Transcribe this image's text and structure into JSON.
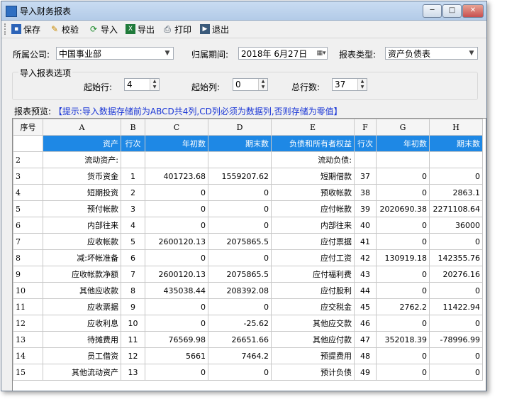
{
  "window": {
    "title": "导入财务报表",
    "min": "─",
    "max": "□",
    "close": "✕"
  },
  "toolbar": [
    {
      "label": "保存",
      "icon": "save-icon"
    },
    {
      "label": "校验",
      "icon": "check-icon"
    },
    {
      "label": "导入",
      "icon": "import-icon"
    },
    {
      "label": "导出",
      "icon": "export-icon"
    },
    {
      "label": "打印",
      "icon": "print-icon"
    },
    {
      "label": "退出",
      "icon": "exit-icon"
    }
  ],
  "form": {
    "company_label": "所属公司:",
    "company_value": "中国事业部",
    "period_label": "归属期间:",
    "period_value": "2018年  6月27日",
    "report_type_label": "报表类型:",
    "report_type_value": "资产负债表",
    "group_title": "导入报表选项",
    "start_row_label": "起始行:",
    "start_row_value": "4",
    "start_col_label": "起始列:",
    "start_col_value": "0",
    "total_rows_label": "总行数:",
    "total_rows_value": "37"
  },
  "preview": {
    "label": "报表预览:",
    "hint": "【提示:导入数据存储前为ABCD共4列,CD列必须为数据列,否则存储为零值】"
  },
  "grid": {
    "columns": [
      "序号",
      "A",
      "B",
      "C",
      "D",
      "E",
      "F",
      "G",
      "H"
    ],
    "header_row": [
      "",
      "资产",
      "行次",
      "年初数",
      "期末数",
      "负债和所有者权益",
      "行次",
      "年初数",
      "期末数"
    ],
    "rows": [
      [
        "2",
        "流动资产:",
        "",
        "",
        "",
        "流动负债:",
        "",
        "",
        ""
      ],
      [
        "3",
        "货币资金",
        "1",
        "401723.68",
        "1559207.62",
        "短期借款",
        "37",
        "0",
        "0"
      ],
      [
        "4",
        "短期投资",
        "2",
        "0",
        "0",
        "预收帐款",
        "38",
        "0",
        "2863.1"
      ],
      [
        "5",
        "预付帐款",
        "3",
        "0",
        "0",
        "应付帐款",
        "39",
        "2020690.38",
        "2271108.64"
      ],
      [
        "6",
        "内部往来",
        "4",
        "0",
        "0",
        "内部往来",
        "40",
        "0",
        "36000"
      ],
      [
        "7",
        "应收帐款",
        "5",
        "2600120.13",
        "2075865.5",
        "应付票据",
        "41",
        "0",
        "0"
      ],
      [
        "8",
        "减:坏帐准备",
        "6",
        "0",
        "0",
        "应付工资",
        "42",
        "130919.18",
        "142355.76"
      ],
      [
        "9",
        "应收帐款净额",
        "7",
        "2600120.13",
        "2075865.5",
        "应付福利费",
        "43",
        "0",
        "20276.16"
      ],
      [
        "10",
        "其他应收款",
        "8",
        "435038.44",
        "208392.08",
        "应付股利",
        "44",
        "0",
        "0"
      ],
      [
        "11",
        "应收票据",
        "9",
        "0",
        "0",
        "应交税金",
        "45",
        "2762.2",
        "11422.94"
      ],
      [
        "12",
        "应收利息",
        "10",
        "0",
        "-25.62",
        "其他应交款",
        "46",
        "0",
        "0"
      ],
      [
        "13",
        "待摊费用",
        "11",
        "76569.98",
        "26651.66",
        "其他应付款",
        "47",
        "352018.39",
        "-78996.99"
      ],
      [
        "14",
        "员工借资",
        "12",
        "5661",
        "7464.2",
        "预提费用",
        "48",
        "0",
        "0"
      ],
      [
        "15",
        "其他流动资产",
        "13",
        "0",
        "0",
        "预计负债",
        "49",
        "0",
        "0"
      ]
    ]
  },
  "colors": {
    "header_blue": "#1e88e5",
    "hint_blue": "#1a36d6"
  }
}
